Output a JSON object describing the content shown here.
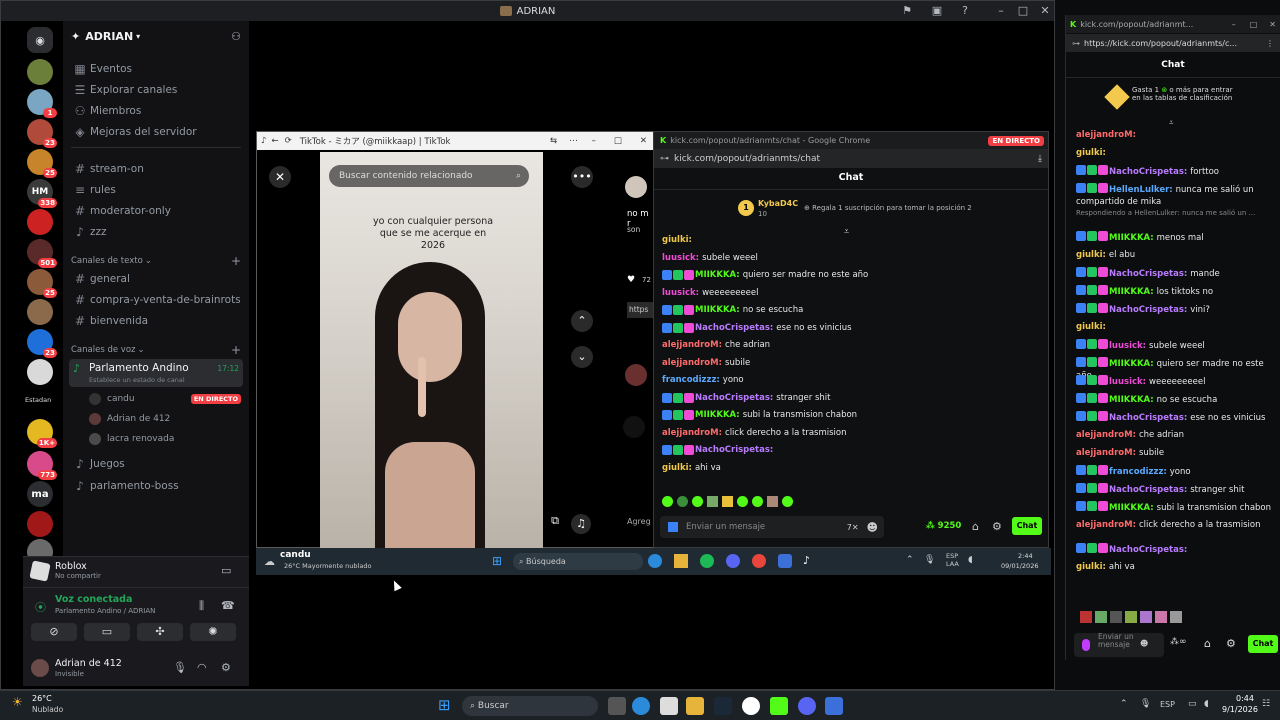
{
  "discord": {
    "title": "ADRIAN",
    "server_name": "ADRIAN",
    "server_badges": [
      "1",
      "23",
      "25",
      "338",
      "501",
      "25",
      "23",
      "1K+",
      "773"
    ],
    "server_text_hm": "HM",
    "server_text_ma": "ma",
    "server_text_estadan": "Estadan",
    "nav": [
      "Eventos",
      "Explorar canales",
      "Miembros",
      "Mejoras del servidor"
    ],
    "channels_top": [
      "stream-on",
      "rules",
      "moderator-only",
      "zzz"
    ],
    "text_category": "Canales de texto",
    "text_channels": [
      "general",
      "compra-y-venta-de-brainrots",
      "bienvenida"
    ],
    "voice_category": "Canales de voz",
    "voice_channel": {
      "name": "Parlamento Andino",
      "status": "Establece un estado de canal",
      "time": "17:12"
    },
    "voice_users": [
      {
        "name": "candu",
        "badge": "EN DIRECTO"
      },
      {
        "name": "Adrian de 412",
        "badge": ""
      },
      {
        "name": "lacra renovada",
        "badge": ""
      }
    ],
    "voice_channels_more": [
      "Juegos",
      "parlamento-boss"
    ],
    "activity": {
      "game": "Roblox",
      "sub": "No compartir"
    },
    "voice_connected": {
      "label": "Voz conectada",
      "where": "Parlamento Andino / ADRIAN"
    },
    "user": {
      "name": "Adrian de 412",
      "status": "Invisible"
    }
  },
  "tiktok": {
    "title": "TikTok - ミカア (@miikkaap) | TikTok",
    "search_placeholder": "Buscar contenido relacionado",
    "caption": "yo con cualquier persona que se me acerque en 2026",
    "side_text_1": "no m r",
    "side_text_2": "son",
    "side_text_3": "72",
    "side_text_4": "https",
    "side_text_5": "Agreg"
  },
  "kick_popup": {
    "titlebar": "kick.com/popout/adrianmts/chat - Google Chrome",
    "live_badge": "EN DIRECTO",
    "url": "kick.com/popout/adrianmts/chat",
    "header": "Chat",
    "gifter": {
      "name": "KybaD4C",
      "count": "10",
      "prompt": "Regala 1 suscripción para tomar la posición 2"
    },
    "messages": [
      {
        "user": "giulki",
        "text": "",
        "color": "#f2c94c"
      },
      {
        "user": "luusick",
        "text": "subele weeel",
        "color": "#ef4bd6"
      },
      {
        "user": "MIIKKKA",
        "text": "quiero ser madre no este año",
        "color": "#53fc18"
      },
      {
        "user": "luusick",
        "text": "weeeeeeeeel",
        "color": "#ef4bd6"
      },
      {
        "user": "MIIKKKA",
        "text": "no se escucha",
        "color": "#53fc18"
      },
      {
        "user": "NachoCrispetas",
        "text": "ese no es vinicius",
        "color": "#b97cff"
      },
      {
        "user": "alejjandroM",
        "text": "che adrian",
        "color": "#ff6b6b"
      },
      {
        "user": "alejjandroM",
        "text": "subile",
        "color": "#ff6b6b"
      },
      {
        "user": "francodizzz",
        "text": "yono",
        "color": "#5aa9ff"
      },
      {
        "user": "NachoCrispetas",
        "text": "stranger shit",
        "color": "#b97cff"
      },
      {
        "user": "MIIKKKA",
        "text": "subi la transmision chabon",
        "color": "#53fc18"
      },
      {
        "user": "alejjandroM",
        "text": "click derecho a la trasmision",
        "color": "#ff6b6b"
      },
      {
        "user": "NachoCrispetas",
        "text": "",
        "color": "#b97cff"
      },
      {
        "user": "giulki",
        "text": "ahi va",
        "color": "#f2c94c"
      }
    ],
    "input_placeholder": "Enviar un mensaje",
    "points": "9250",
    "send_label": "Chat"
  },
  "inner_taskbar": {
    "weather": "26°C Mayormente nublado",
    "label": "candu",
    "search": "Búsqueda",
    "lang": "ESP LAA",
    "time": "2:44",
    "date": "09/01/2026"
  },
  "kick_side": {
    "tab_title": "kick.com/popout/adrianmt...",
    "url": "https://kick.com/popout/adrianmts/c...",
    "header": "Chat",
    "promo_a": "Gasta 1",
    "promo_b": "o más para entrar en las tablas de clasificación",
    "messages": [
      {
        "user": "alejjandroM",
        "text": "",
        "color": "#ff6b6b"
      },
      {
        "user": "giulki",
        "text": "",
        "color": "#f2c94c"
      },
      {
        "user": "NachoCrispetas",
        "text": "forttoo",
        "color": "#b97cff"
      },
      {
        "user": "HellenLulker",
        "text": "nunca me salió un compartido de mika",
        "color": "#5aa9ff"
      },
      {
        "user": "",
        "text": "Respondiendo a HellenLulker: nunca me salió un ...",
        "color": "#888"
      },
      {
        "user": "MIIKKKA",
        "text": "menos mal",
        "color": "#53fc18"
      },
      {
        "user": "giulki",
        "text": "el abu",
        "color": "#f2c94c"
      },
      {
        "user": "NachoCrispetas",
        "text": "mande",
        "color": "#b97cff"
      },
      {
        "user": "MIIKKKA",
        "text": "los tiktoks no",
        "color": "#53fc18"
      },
      {
        "user": "NachoCrispetas",
        "text": "vini?",
        "color": "#b97cff"
      },
      {
        "user": "giulki",
        "text": "",
        "color": "#f2c94c"
      },
      {
        "user": "luusick",
        "text": "subele weeel",
        "color": "#ef4bd6"
      },
      {
        "user": "MIIKKKA",
        "text": "quiero ser madre no este año",
        "color": "#53fc18"
      },
      {
        "user": "luusick",
        "text": "weeeeeeeeel",
        "color": "#ef4bd6"
      },
      {
        "user": "MIIKKKA",
        "text": "no se escucha",
        "color": "#53fc18"
      },
      {
        "user": "NachoCrispetas",
        "text": "ese no es vinicius",
        "color": "#b97cff"
      },
      {
        "user": "alejjandroM",
        "text": "che adrian",
        "color": "#ff6b6b"
      },
      {
        "user": "alejjandroM",
        "text": "subile",
        "color": "#ff6b6b"
      },
      {
        "user": "francodizzz",
        "text": "yono",
        "color": "#5aa9ff"
      },
      {
        "user": "NachoCrispetas",
        "text": "stranger shit",
        "color": "#b97cff"
      },
      {
        "user": "MIIKKKA",
        "text": "subi la transmision chabon",
        "color": "#53fc18"
      },
      {
        "user": "alejjandroM",
        "text": "click derecho a la trasmision",
        "color": "#ff6b6b"
      },
      {
        "user": "NachoCrispetas",
        "text": "",
        "color": "#b97cff"
      },
      {
        "user": "giulki",
        "text": "ahi va",
        "color": "#f2c94c"
      }
    ],
    "input_placeholder": "Enviar un mensaje",
    "send_label": "Chat"
  },
  "taskbar": {
    "weather_temp": "26°C",
    "weather_desc": "Nublado",
    "search": "Buscar",
    "lang": "ESP",
    "time": "0:44",
    "date": "9/1/2026"
  },
  "colors": {
    "kick_green": "#53fc18",
    "discord_red": "#f23f43",
    "discord_bg": "#121214"
  }
}
